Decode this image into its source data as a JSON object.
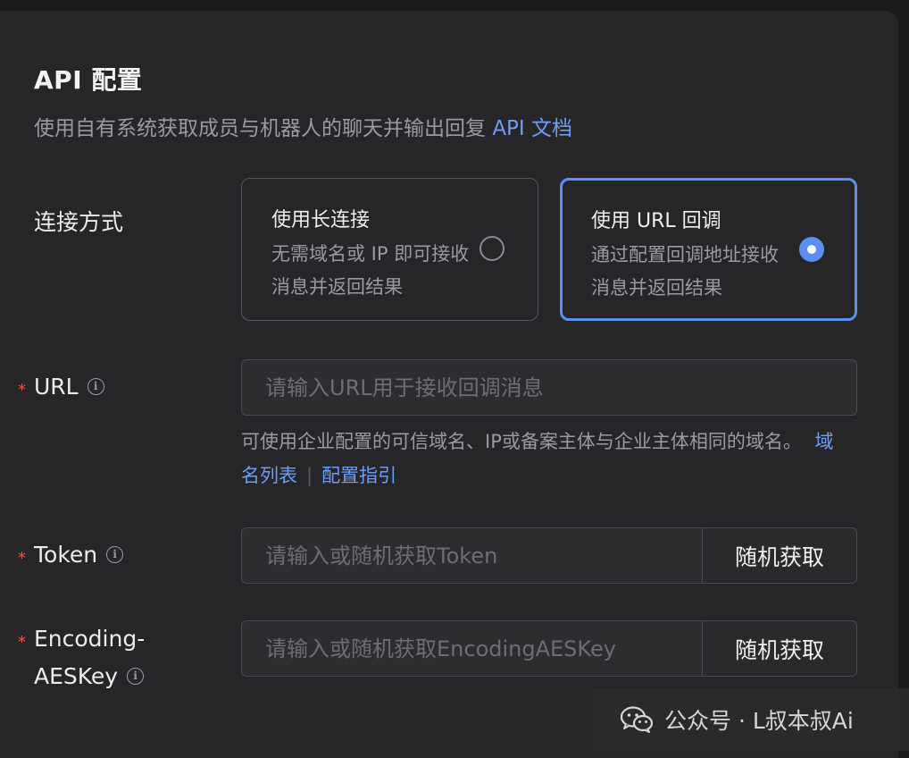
{
  "header": {
    "title": "API 配置",
    "subtitle": "使用自有系统获取成员与机器人的聊天并输出回复",
    "docs_link": "API 文档"
  },
  "connection": {
    "label": "连接方式",
    "options": [
      {
        "title": "使用长连接",
        "desc": "无需域名或 IP 即可接收消息并返回结果",
        "selected": false
      },
      {
        "title": "使用 URL 回调",
        "desc": "通过配置回调地址接收消息并返回结果",
        "selected": true
      }
    ]
  },
  "url_field": {
    "label": "URL",
    "required_mark": "*",
    "placeholder": "请输入URL用于接收回调消息",
    "value": "",
    "help": "可使用企业配置的可信域名、IP或备案主体与企业主体相同的域名。",
    "link_domains": "域名列表",
    "separator": "|",
    "link_guide": "配置指引"
  },
  "token_field": {
    "label": "Token",
    "required_mark": "*",
    "placeholder": "请输入或随机获取Token",
    "value": "",
    "button": "随机获取"
  },
  "aes_field": {
    "label_line1": "Encoding-",
    "label_line2": "AESKey",
    "required_mark": "*",
    "placeholder": "请输入或随机获取EncodingAESKey",
    "value": "",
    "button": "随机获取"
  },
  "watermark": {
    "text": "公众号 · L叔本叔Ai",
    "icon": "wechat-icon"
  },
  "colors": {
    "accent": "#5d8ef1",
    "link": "#6f9cf5",
    "required": "#e5573f",
    "background": "#262628"
  }
}
